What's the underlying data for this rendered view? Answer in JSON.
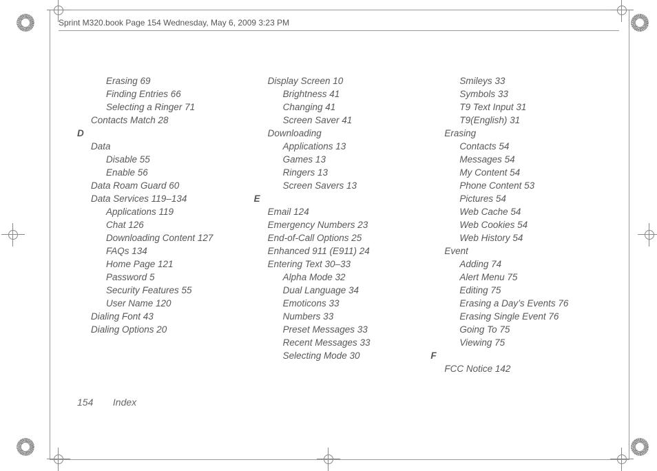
{
  "header": "Sprint M320.book  Page 154  Wednesday, May 6, 2009  3:23 PM",
  "footer": {
    "page": "154",
    "section": "Index"
  },
  "col1": [
    {
      "lvl": 2,
      "t": "Erasing 69"
    },
    {
      "lvl": 2,
      "t": "Finding Entries 66"
    },
    {
      "lvl": 2,
      "t": "Selecting a Ringer 71"
    },
    {
      "lvl": 1,
      "t": "Contacts Match 28"
    },
    {
      "lvl": 0,
      "t": "D",
      "letter": true
    },
    {
      "lvl": 1,
      "t": "Data"
    },
    {
      "lvl": 2,
      "t": "Disable 55"
    },
    {
      "lvl": 2,
      "t": "Enable 56"
    },
    {
      "lvl": 1,
      "t": "Data Roam Guard 60"
    },
    {
      "lvl": 1,
      "t": "Data Services 119–134"
    },
    {
      "lvl": 2,
      "t": "Applications 119"
    },
    {
      "lvl": 2,
      "t": "Chat 126"
    },
    {
      "lvl": 2,
      "t": "Downloading Content 127"
    },
    {
      "lvl": 2,
      "t": "FAQs 134"
    },
    {
      "lvl": 2,
      "t": "Home Page 121"
    },
    {
      "lvl": 2,
      "t": "Password 5"
    },
    {
      "lvl": 2,
      "t": "Security Features 55"
    },
    {
      "lvl": 2,
      "t": "User Name 120"
    },
    {
      "lvl": 1,
      "t": "Dialing Font 43"
    },
    {
      "lvl": 1,
      "t": "Dialing Options 20"
    }
  ],
  "col2": [
    {
      "lvl": 1,
      "t": "Display Screen 10"
    },
    {
      "lvl": 2,
      "t": "Brightness 41"
    },
    {
      "lvl": 2,
      "t": "Changing 41"
    },
    {
      "lvl": 2,
      "t": "Screen Saver 41"
    },
    {
      "lvl": 1,
      "t": "Downloading"
    },
    {
      "lvl": 2,
      "t": "Applications 13"
    },
    {
      "lvl": 2,
      "t": "Games 13"
    },
    {
      "lvl": 2,
      "t": "Ringers 13"
    },
    {
      "lvl": 2,
      "t": "Screen Savers 13"
    },
    {
      "lvl": 0,
      "t": "E",
      "letter": true
    },
    {
      "lvl": 1,
      "t": "Email 124"
    },
    {
      "lvl": 1,
      "t": "Emergency Numbers 23"
    },
    {
      "lvl": 1,
      "t": "End-of-Call Options 25"
    },
    {
      "lvl": 1,
      "t": "Enhanced 911 (E911) 24"
    },
    {
      "lvl": 1,
      "t": "Entering Text 30–33"
    },
    {
      "lvl": 2,
      "t": "Alpha Mode 32"
    },
    {
      "lvl": 2,
      "t": "Dual Language 34"
    },
    {
      "lvl": 2,
      "t": "Emoticons 33"
    },
    {
      "lvl": 2,
      "t": "Numbers 33"
    },
    {
      "lvl": 2,
      "t": "Preset Messages 33"
    },
    {
      "lvl": 2,
      "t": "Recent Messages 33"
    },
    {
      "lvl": 2,
      "t": "Selecting Mode 30"
    }
  ],
  "col3": [
    {
      "lvl": 2,
      "t": "Smileys 33"
    },
    {
      "lvl": 2,
      "t": "Symbols 33"
    },
    {
      "lvl": 2,
      "t": "T9 Text Input 31"
    },
    {
      "lvl": 2,
      "t": "T9(English) 31"
    },
    {
      "lvl": 1,
      "t": "Erasing"
    },
    {
      "lvl": 2,
      "t": "Contacts 54"
    },
    {
      "lvl": 2,
      "t": "Messages 54"
    },
    {
      "lvl": 2,
      "t": "My Content 54"
    },
    {
      "lvl": 2,
      "t": "Phone Content 53"
    },
    {
      "lvl": 2,
      "t": "Pictures 54"
    },
    {
      "lvl": 2,
      "t": "Web Cache 54"
    },
    {
      "lvl": 2,
      "t": "Web Cookies 54"
    },
    {
      "lvl": 2,
      "t": "Web History 54"
    },
    {
      "lvl": 1,
      "t": "Event"
    },
    {
      "lvl": 2,
      "t": "Adding 74"
    },
    {
      "lvl": 2,
      "t": "Alert Menu 75"
    },
    {
      "lvl": 2,
      "t": "Editing 75"
    },
    {
      "lvl": 2,
      "t": "Erasing a Day’s Events 76"
    },
    {
      "lvl": 2,
      "t": "Erasing Single Event 76"
    },
    {
      "lvl": 2,
      "t": "Going To 75"
    },
    {
      "lvl": 2,
      "t": "Viewing 75"
    },
    {
      "lvl": 0,
      "t": "F",
      "letter": true
    },
    {
      "lvl": 1,
      "t": "FCC Notice 142"
    }
  ]
}
